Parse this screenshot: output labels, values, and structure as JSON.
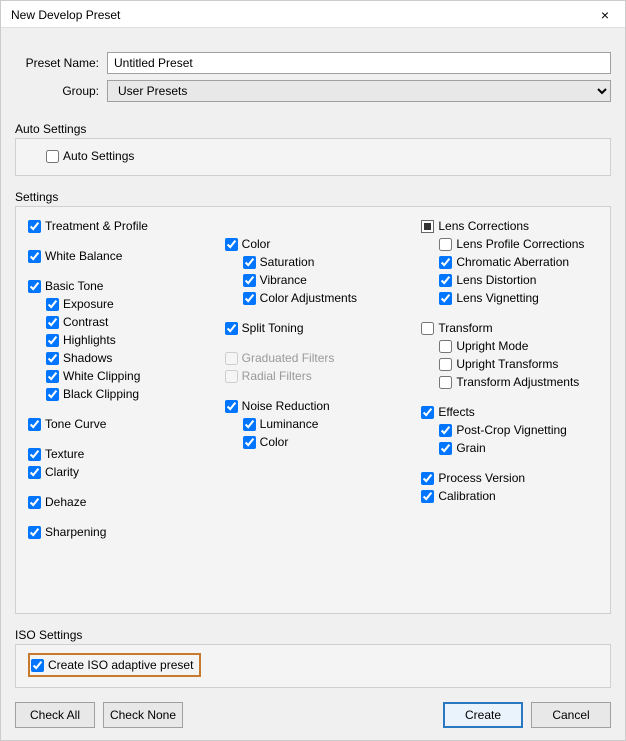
{
  "window": {
    "title": "New Develop Preset",
    "close": "×"
  },
  "form": {
    "presetNameLabel": "Preset Name:",
    "presetNameValue": "Untitled Preset",
    "groupLabel": "Group:",
    "groupValue": "User Presets"
  },
  "autoSettings": {
    "sectionLabel": "Auto Settings",
    "autoSettings": "Auto Settings"
  },
  "settings": {
    "sectionLabel": "Settings",
    "col1": {
      "treatmentProfile": "Treatment & Profile",
      "whiteBalance": "White Balance",
      "basicTone": "Basic Tone",
      "exposure": "Exposure",
      "contrast": "Contrast",
      "highlights": "Highlights",
      "shadows": "Shadows",
      "whiteClipping": "White Clipping",
      "blackClipping": "Black Clipping",
      "toneCurve": "Tone Curve",
      "texture": "Texture",
      "clarity": "Clarity",
      "dehaze": "Dehaze",
      "sharpening": "Sharpening"
    },
    "col2": {
      "color": "Color",
      "saturation": "Saturation",
      "vibrance": "Vibrance",
      "colorAdjustments": "Color Adjustments",
      "splitToning": "Split Toning",
      "graduatedFilters": "Graduated Filters",
      "radialFilters": "Radial Filters",
      "noiseReduction": "Noise Reduction",
      "luminance": "Luminance",
      "colorNR": "Color"
    },
    "col3": {
      "lensCorrections": "Lens Corrections",
      "lensProfileCorrections": "Lens Profile Corrections",
      "chromaticAberration": "Chromatic Aberration",
      "lensDistortion": "Lens Distortion",
      "lensVignetting": "Lens Vignetting",
      "transform": "Transform",
      "uprightMode": "Upright Mode",
      "uprightTransforms": "Upright Transforms",
      "transformAdjustments": "Transform Adjustments",
      "effects": "Effects",
      "postCropVignetting": "Post-Crop Vignetting",
      "grain": "Grain",
      "processVersion": "Process Version",
      "calibration": "Calibration"
    }
  },
  "isoSettings": {
    "sectionLabel": "ISO Settings",
    "createIso": "Create ISO adaptive preset"
  },
  "buttons": {
    "checkAll": "Check All",
    "checkNone": "Check None",
    "create": "Create",
    "cancel": "Cancel"
  }
}
